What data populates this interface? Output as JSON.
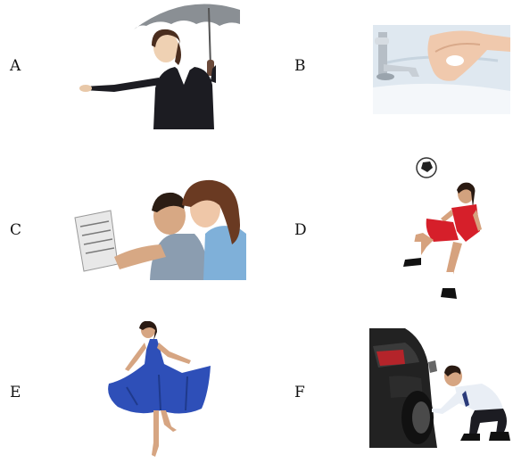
{
  "items": [
    {
      "letter": "A",
      "icon": "woman-with-umbrella-icon"
    },
    {
      "letter": "B",
      "icon": "washing-hands-icon"
    },
    {
      "letter": "C",
      "icon": "couple-reading-newspaper-icon"
    },
    {
      "letter": "D",
      "icon": "girl-kicking-ball-icon"
    },
    {
      "letter": "E",
      "icon": "girl-dancing-icon"
    },
    {
      "letter": "F",
      "icon": "man-fixing-car-tire-icon"
    }
  ],
  "colors": {
    "blazer": "#1c1c22",
    "umbrella": "#8a8f94",
    "sink": "#dfe8f0",
    "jersey": "#d61f2a",
    "dress": "#2e4fb8",
    "car": "#222222"
  }
}
